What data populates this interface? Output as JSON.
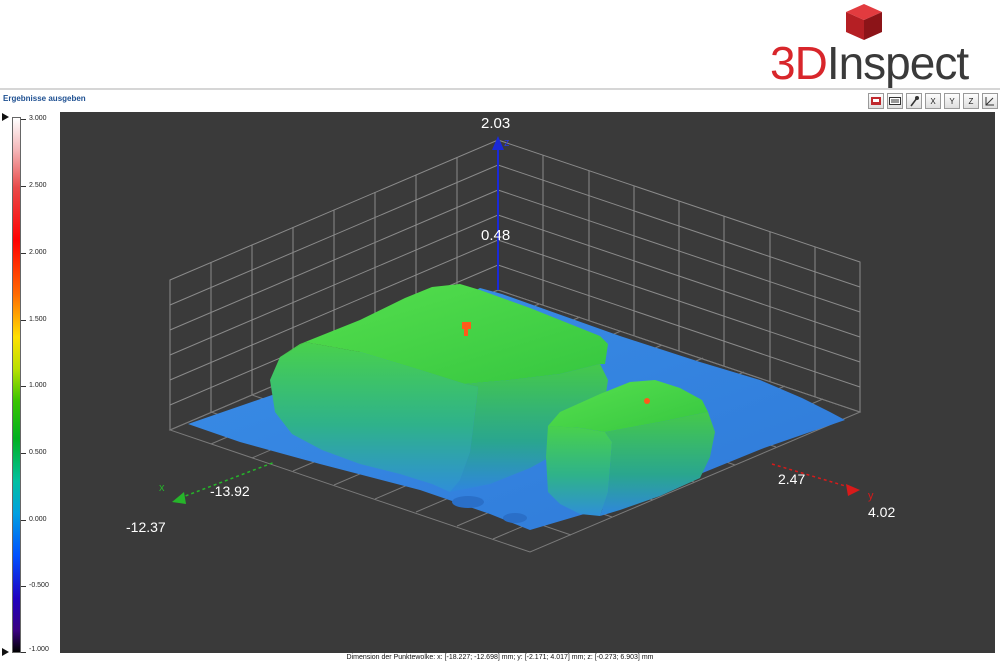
{
  "brand": {
    "prefix": "3D",
    "rest": "Inspect"
  },
  "panel": {
    "title": "Ergebnisse ausgeben"
  },
  "toolbar": {
    "buttons": [
      "",
      "",
      "",
      "X",
      "Y",
      "Z",
      ""
    ]
  },
  "legend": {
    "ticks": [
      "3.000",
      "2.500",
      "2.000",
      "1.500",
      "1.000",
      "0.500",
      "0.000",
      "-0.500",
      "-1.000"
    ]
  },
  "plot": {
    "z_top": "2.03",
    "z_mid": "0.48",
    "z_axis": "z",
    "x_axis": "x",
    "y_axis": "y",
    "x_min": "-12.37",
    "x_inner": "-13.92",
    "y_inner": "2.47",
    "y_max": "4.02"
  },
  "footer": {
    "text": "Dimension der Punktewolke:   x: [-18.227; -12.698] mm;   y: [-2.171; 4.017] mm;   z: [-0.273; 6.903] mm"
  },
  "colors": {
    "brand_red": "#d8262b",
    "plateau_green": "#3ccf4a",
    "surface_blue": "#2f7ee0",
    "background": "#3a3a3a"
  }
}
